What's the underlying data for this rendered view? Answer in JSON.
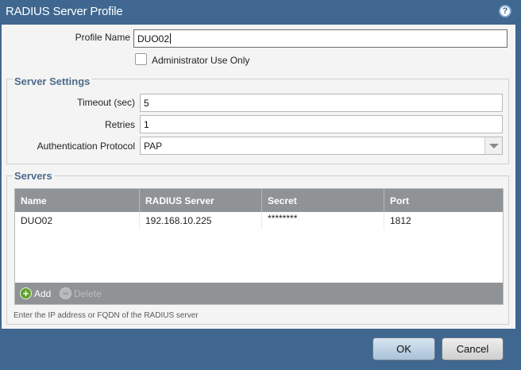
{
  "dialog": {
    "title": "RADIUS Server Profile",
    "help_icon": "?"
  },
  "profile": {
    "name_label": "Profile Name",
    "name_value": "DUO02",
    "admin_only_label": "Administrator Use Only",
    "admin_only_checked": false
  },
  "server_settings": {
    "legend": "Server Settings",
    "timeout_label": "Timeout (sec)",
    "timeout_value": "5",
    "retries_label": "Retries",
    "retries_value": "1",
    "auth_protocol_label": "Authentication Protocol",
    "auth_protocol_value": "PAP"
  },
  "servers": {
    "legend": "Servers",
    "columns": [
      "Name",
      "RADIUS Server",
      "Secret",
      "Port"
    ],
    "rows": [
      {
        "name": "DUO02",
        "radius_server": "192.168.10.225",
        "secret": "********",
        "port": "1812"
      }
    ],
    "add_label": "Add",
    "delete_label": "Delete",
    "hint": "Enter the IP address or FQDN of the RADIUS server"
  },
  "buttons": {
    "ok": "OK",
    "cancel": "Cancel"
  },
  "colors": {
    "titlebar": "#3f6790",
    "legend": "#4d6b8a",
    "grid_header": "#8f9396",
    "add_icon": "#5fa32b"
  }
}
